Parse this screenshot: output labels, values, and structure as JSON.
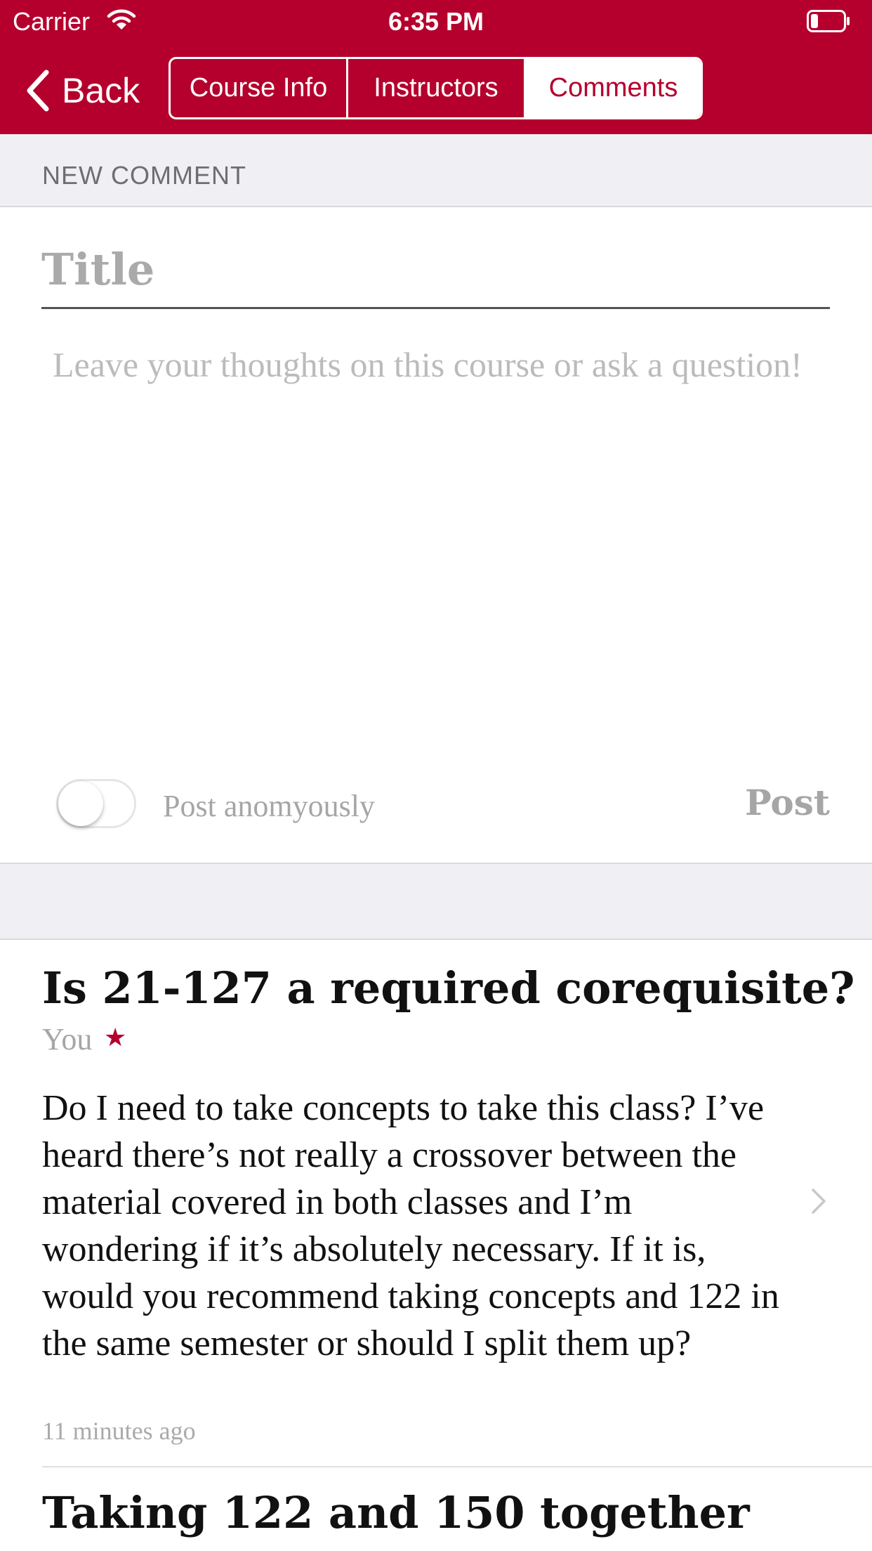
{
  "status_bar": {
    "carrier": "Carrier",
    "time": "6:35 PM",
    "icons": [
      "wifi-icon",
      "battery-icon"
    ]
  },
  "nav": {
    "back_label": "Back",
    "tabs": [
      "Course Info",
      "Instructors",
      "Comments"
    ],
    "selected_tab": "Comments"
  },
  "new_comment": {
    "section_title": "NEW COMMENT",
    "title_placeholder": "Title",
    "body_placeholder": "Leave your thoughts on this course or ask a question!",
    "anonymous_label": "Post anomyously",
    "anonymous_on": false,
    "post_label": "Post"
  },
  "comments": [
    {
      "title": "Is 21-127 a required corequisite?",
      "author": "You",
      "star": "★",
      "body": "Do I need to take concepts to take this class?  I’ve heard there’s not really a crossover between the material covered in both classes and I’m wondering if it’s absolutely necessary.  If it is, would you recommend taking concepts and 122 in the same semester or should I split them up?",
      "time": "11 minutes ago"
    },
    {
      "title": "Taking 122 and 150 together"
    }
  ],
  "colors": {
    "brand": "#B5002D",
    "section_background": "#EFEFF4",
    "placeholder": "#AAAAAA"
  }
}
